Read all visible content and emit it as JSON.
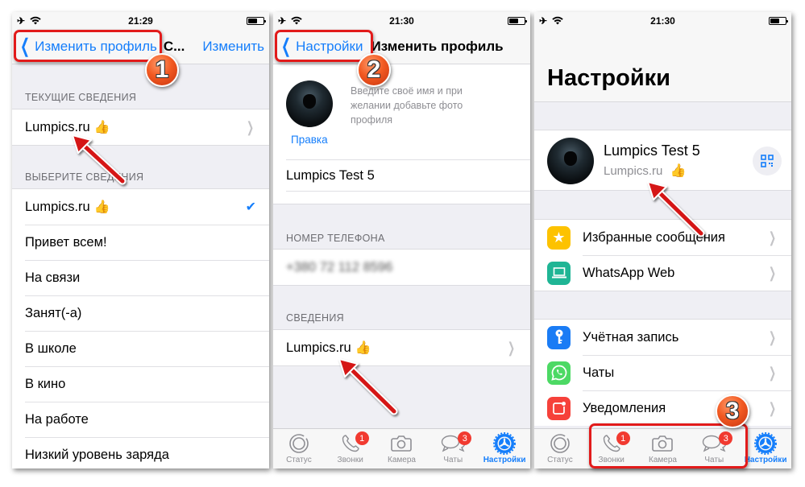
{
  "colors": {
    "accent": "#157efb",
    "badge": "#f13a30",
    "annotation": "#e21b1b"
  },
  "screens": [
    {
      "status": {
        "time": "21:29",
        "left_icons": [
          "airplane-icon",
          "wifi-icon"
        ],
        "battery_level": 0.6
      },
      "nav": {
        "back_label": "Изменить профиль",
        "title": "С...",
        "action_label": "Изменить"
      },
      "current_header": "ТЕКУЩИЕ СВЕДЕНИЯ",
      "current_value": "Lumpics.ru",
      "current_emoji": "👍",
      "choose_header": "ВЫБЕРИТЕ СВЕДЕНИЯ",
      "options": [
        {
          "label": "Lumpics.ru",
          "emoji": "👍",
          "selected": true
        },
        {
          "label": "Привет всем!"
        },
        {
          "label": "На связи"
        },
        {
          "label": "Занят(-а)"
        },
        {
          "label": "В школе"
        },
        {
          "label": "В кино"
        },
        {
          "label": "На работе"
        },
        {
          "label": "Низкий уровень заряда"
        }
      ],
      "step": "1"
    },
    {
      "status": {
        "time": "21:30",
        "left_icons": [
          "airplane-icon",
          "wifi-icon"
        ],
        "battery_level": 0.6
      },
      "nav": {
        "back_label": "Настройки",
        "title": "Изменить профиль"
      },
      "hint": "Введите своё имя и при желании добавьте фото профиля",
      "edit_photo_label": "Правка",
      "name_value": "Lumpics Test 5",
      "phone_header": "НОМЕР ТЕЛЕФОНА",
      "phone_value": "+380 72 112 8596",
      "about_header": "СВЕДЕНИЯ",
      "about_value": "Lumpics.ru",
      "about_emoji": "👍",
      "step": "2"
    },
    {
      "status": {
        "time": "21:30",
        "left_icons": [
          "airplane-icon",
          "wifi-icon"
        ],
        "battery_level": 0.6
      },
      "title": "Настройки",
      "profile": {
        "name": "Lumpics Test 5",
        "status": "Lumpics.ru",
        "emoji": "👍"
      },
      "menu_group_1": [
        {
          "label": "Избранные сообщения",
          "icon": "star-icon",
          "color": "#fdc200"
        },
        {
          "label": "WhatsApp Web",
          "icon": "laptop-icon",
          "color": "#1fb595"
        }
      ],
      "menu_group_2": [
        {
          "label": "Учётная запись",
          "icon": "key-icon",
          "color": "#1a7cf5"
        },
        {
          "label": "Чаты",
          "icon": "whatsapp-icon",
          "color": "#4cd964"
        },
        {
          "label": "Уведомления",
          "icon": "notification-icon",
          "color": "#f6413a"
        }
      ],
      "step": "3"
    }
  ],
  "tabbar": {
    "tabs": [
      {
        "label": "Статус",
        "icon": "status-icon"
      },
      {
        "label": "Звонки",
        "icon": "phone-icon",
        "badge": "1"
      },
      {
        "label": "Камера",
        "icon": "camera-icon"
      },
      {
        "label": "Чаты",
        "icon": "chat-icon",
        "badge": "3"
      },
      {
        "label": "Настройки",
        "icon": "settings-icon",
        "active": true
      }
    ]
  }
}
